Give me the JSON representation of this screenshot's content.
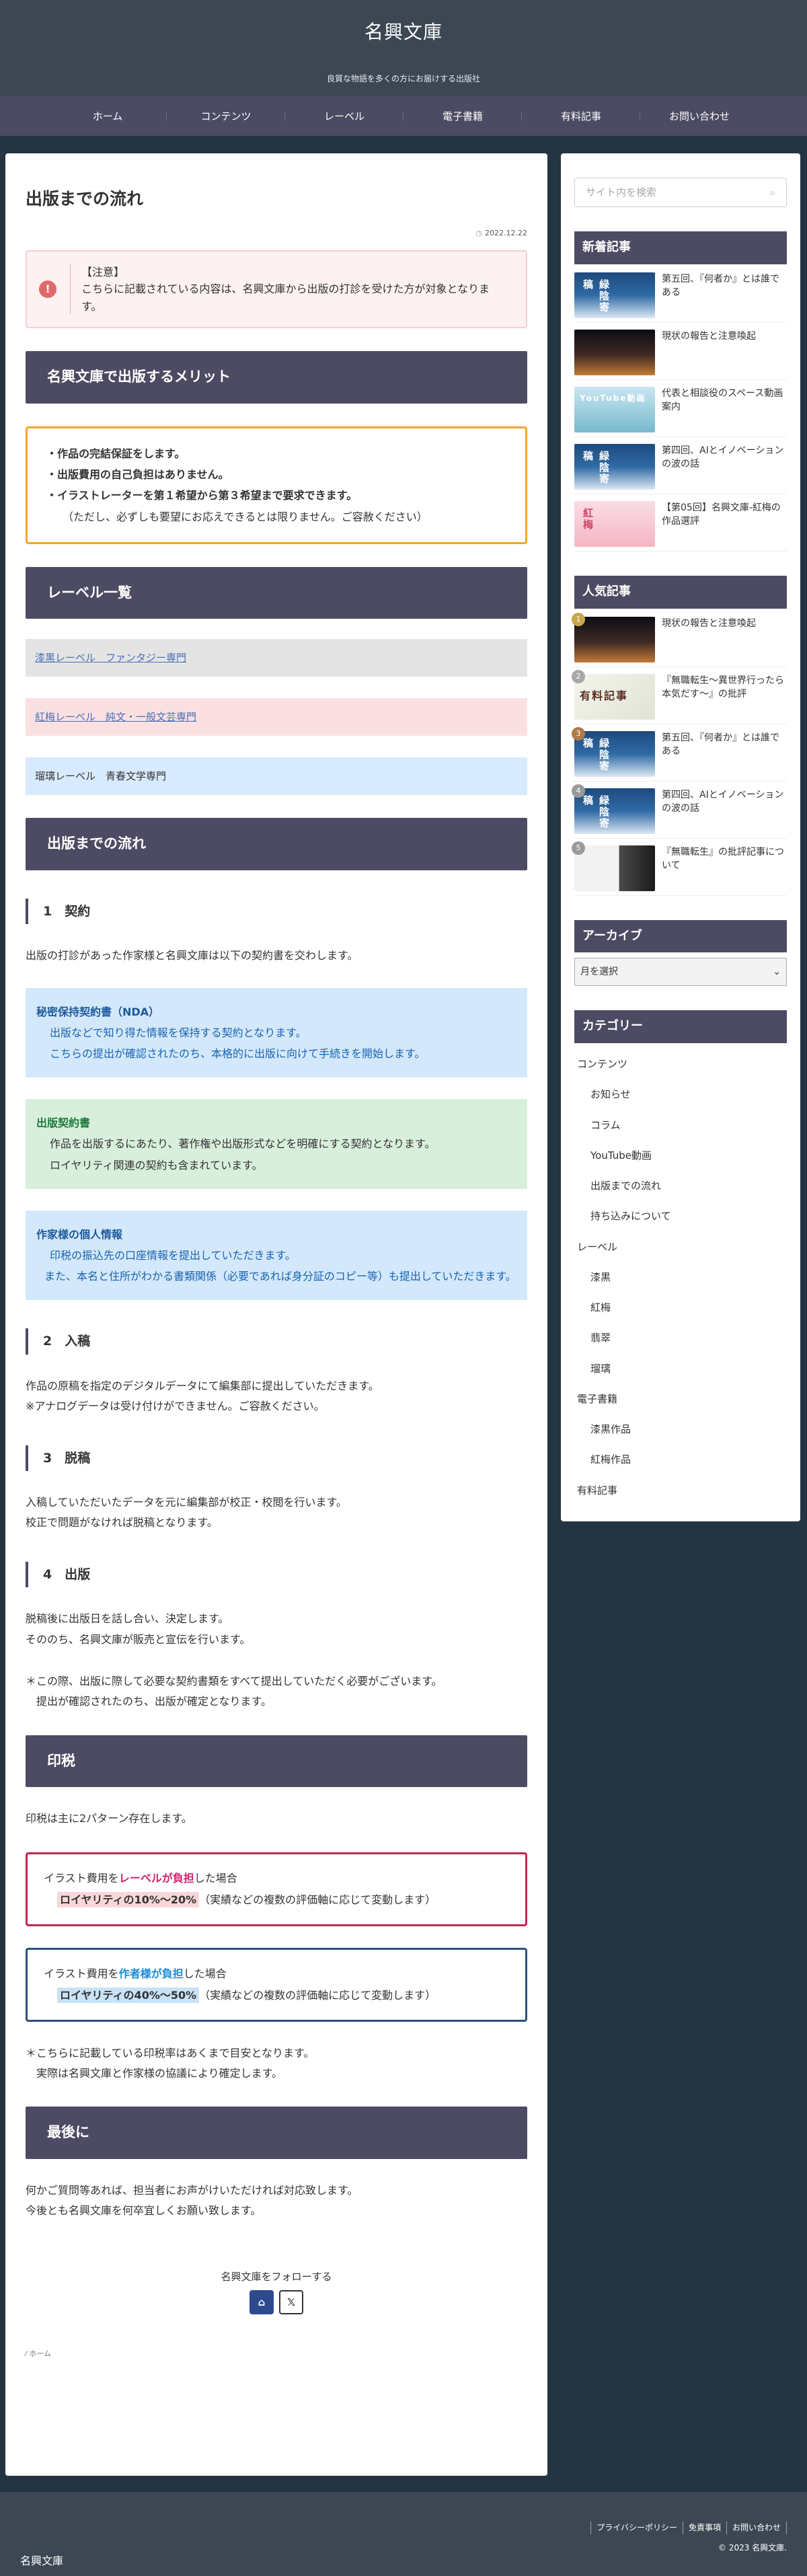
{
  "site": {
    "title": "名興文庫",
    "tagline": "良質な物語を多くの方にお届けする出版社"
  },
  "nav": [
    "ホーム",
    "コンテンツ",
    "レーベル",
    "電子書籍",
    "有料記事",
    "お問い合わせ"
  ],
  "article": {
    "title": "出版までの流れ",
    "date": "2022.12.22",
    "alert": {
      "title": "【注意】",
      "text": "こちらに記載されている内容は、名興文庫から出版の打診を受けた方が対象となります。"
    },
    "merit": {
      "heading": "名興文庫で出版するメリット",
      "lines": [
        "・作品の完結保証をします。",
        "・出版費用の自己負担はありません。",
        "・イラストレーターを第１希望から第３希望まで要求できます。"
      ],
      "note": "（ただし、必ずしも要望にお応えできるとは限りません。ご容赦ください）"
    },
    "labels": {
      "heading": "レーベル一覧",
      "gray": "漆黒レーベル　ファンタジー専門",
      "pink": "紅梅レーベル　純文・一般文芸専門",
      "blue": "瑠璃レーベル　青春文学専門"
    },
    "flow": {
      "heading": "出版までの流れ",
      "step1": {
        "title": "1　契約",
        "intro": "出版の打診があった作家様と名興文庫は以下の契約書を交わします。",
        "nda_title": "秘密保持契約書（NDA）",
        "nda_body1": "出版などで知り得た情報を保持する契約となります。",
        "nda_body2": "こちらの提出が確認されたのち、本格的に出版に向けて手続きを開始します。",
        "pub_title": "出版契約書",
        "pub_body1": "作品を出版するにあたり、著作権や出版形式などを明確にする契約となります。",
        "pub_body2": "ロイヤリティ関連の契約も含まれています。",
        "info_title": "作家様の個人情報",
        "info_body1": "印税の振込先の口座情報を提出していただきます。",
        "info_body2": "また、本名と住所がわかる書類関係（必要であれば身分証のコピー等）も提出していただきます。"
      },
      "step2": {
        "title": "2　入稿",
        "line1": "作品の原稿を指定のデジタルデータにて編集部に提出していただきます。",
        "line2": "※アナログデータは受け付けができません。ご容赦ください。"
      },
      "step3": {
        "title": "3　脱稿",
        "line1": "入稿していただいたデータを元に編集部が校正・校閲を行います。",
        "line2": "校正で問題がなければ脱稿となります。"
      },
      "step4": {
        "title": "4　出版",
        "line1": "脱稿後に出版日を話し合い、決定します。",
        "line2": "そののち、名興文庫が販売と宣伝を行います。",
        "line3": "＊この際、出版に際して必要な契約書類をすべて提出していただく必要がございます。",
        "line4": "　提出が確認されたのち、出版が確定となります。"
      }
    },
    "royalty": {
      "heading": "印税",
      "intro": "印税は主に2パターン存在します。",
      "a_prefix": "イラスト費用を",
      "a_highlight": "レーベルが負担",
      "a_suffix": "した場合",
      "a_pct": "ロイヤリティの10%～20%",
      "a_note": "（実績などの複数の評価軸に応じて変動します）",
      "b_prefix": "イラスト費用を",
      "b_highlight": "作者様が負担",
      "b_suffix": "した場合",
      "b_pct": "ロイヤリティの40%～50%",
      "b_note": "（実績などの複数の評価軸に応じて変動します）",
      "footnote1": "＊こちらに記載している印税率はあくまで目安となります。",
      "footnote2": "　実際は名興文庫と作家様の協議により確定します。"
    },
    "closing": {
      "heading": "最後に",
      "line1": "何かご質問等あれば、担当者にお声がけいただければ対応致します。",
      "line2": "今後とも名興文庫を何卒宜しくお願い致します。"
    },
    "follow": "名興文庫をフォローする",
    "breadcrumb": "ホーム"
  },
  "sidebar": {
    "search_placeholder": "サイト内を検索",
    "new_heading": "新着記事",
    "new_posts": [
      {
        "title": "第五回、『何者か』とは誰である",
        "thumb": "t-ocean",
        "label": "緑陰寄稿"
      },
      {
        "title": "現状の報告と注意喚起",
        "thumb": "t-sunset",
        "label": ""
      },
      {
        "title": "代表と相談役のスペース動画案内",
        "thumb": "t-youtube",
        "label": "YouTube動画"
      },
      {
        "title": "第四回、AIとイノベーションの波の話",
        "thumb": "t-ocean",
        "label": "緑陰寄稿"
      },
      {
        "title": "【第05回】名興文庫-紅梅の作品選評",
        "thumb": "t-sakura",
        "label": "紅梅"
      }
    ],
    "popular_heading": "人気記事",
    "popular_posts": [
      {
        "rank": "1",
        "title": "現状の報告と注意喚起",
        "thumb": "t-sunset",
        "label": ""
      },
      {
        "rank": "2",
        "title": "『無職転生～異世界行ったら本気だす～』の批評",
        "thumb": "t-yuukou",
        "label": "有料記事"
      },
      {
        "rank": "3",
        "title": "第五回、『何者か』とは誰である",
        "thumb": "t-ocean",
        "label": "緑陰寄稿"
      },
      {
        "rank": "4",
        "title": "第四回、AIとイノベーションの波の話",
        "thumb": "t-ocean",
        "label": "緑陰寄稿"
      },
      {
        "rank": "5",
        "title": "『無職転生』の批評記事について",
        "thumb": "t-tensei",
        "label": ""
      }
    ],
    "archive_heading": "アーカイブ",
    "archive_select": "月を選択",
    "category_heading": "カテゴリー",
    "categories": [
      {
        "label": "コンテンツ",
        "sub": false
      },
      {
        "label": "お知らせ",
        "sub": true
      },
      {
        "label": "コラム",
        "sub": true
      },
      {
        "label": "YouTube動画",
        "sub": true
      },
      {
        "label": "出版までの流れ",
        "sub": true
      },
      {
        "label": "持ち込みについて",
        "sub": true
      },
      {
        "label": "レーベル",
        "sub": false
      },
      {
        "label": "漆黒",
        "sub": true
      },
      {
        "label": "紅梅",
        "sub": true
      },
      {
        "label": "翡翠",
        "sub": true
      },
      {
        "label": "瑠璃",
        "sub": true
      },
      {
        "label": "電子書籍",
        "sub": false
      },
      {
        "label": "漆黒作品",
        "sub": true
      },
      {
        "label": "紅梅作品",
        "sub": true
      },
      {
        "label": "有料記事",
        "sub": false
      }
    ]
  },
  "footer": {
    "links": [
      "プライバシーポリシー",
      "免責事項",
      "お問い合わせ"
    ],
    "copyright": "© 2023 名興文庫.",
    "name": "名興文庫"
  }
}
